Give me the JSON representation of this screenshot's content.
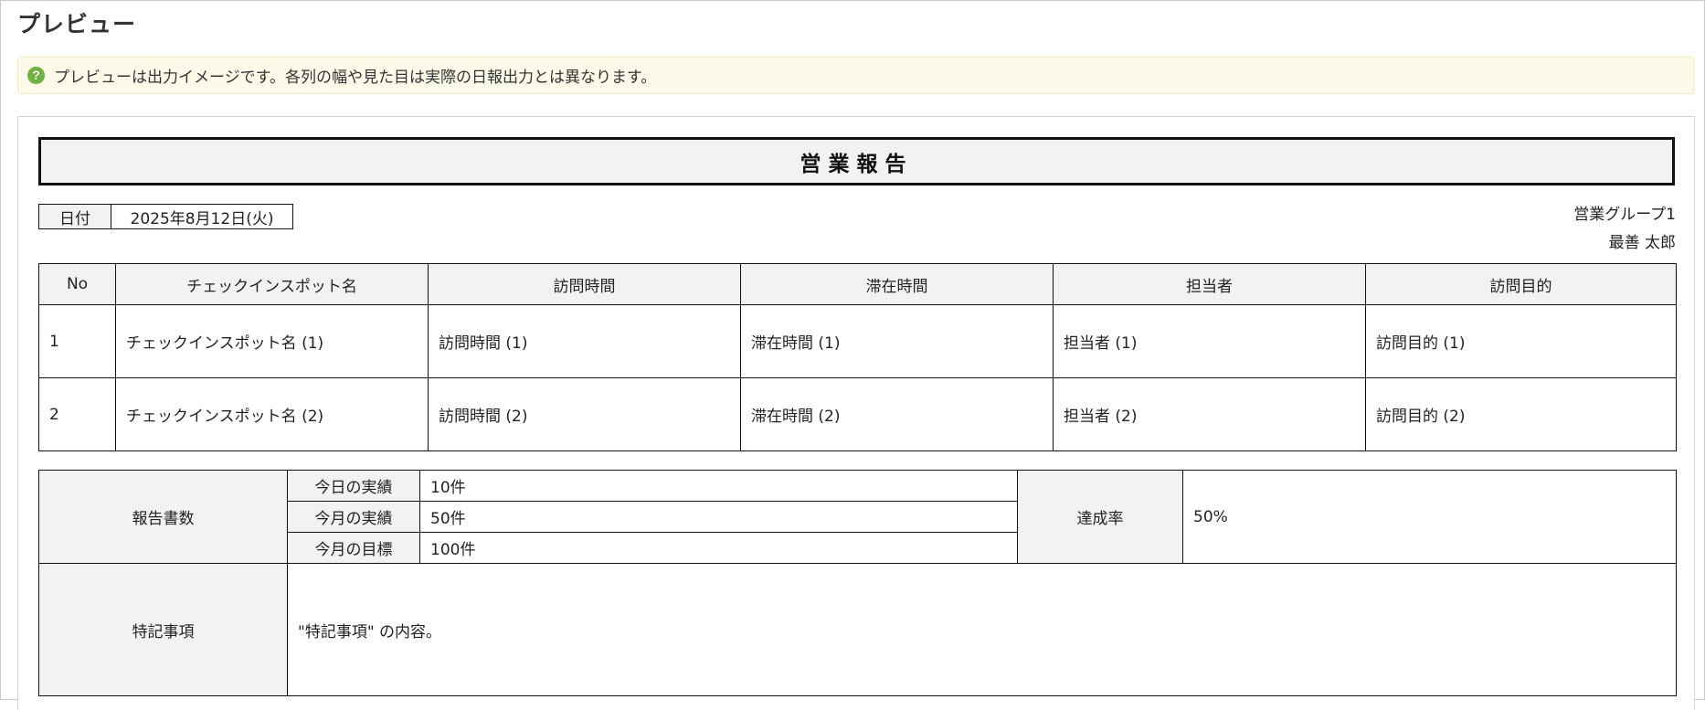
{
  "page": {
    "title": "プレビュー",
    "notice": "プレビューは出力イメージです。各列の幅や見た目は実際の日報出力とは異なります。"
  },
  "report": {
    "title": "営業報告",
    "date_label": "日付",
    "date_value": "2025年8月12日(火)",
    "group": "営業グループ1",
    "user": "最善 太郎"
  },
  "visits": {
    "columns": [
      "No",
      "チェックインスポット名",
      "訪問時間",
      "滞在時間",
      "担当者",
      "訪問目的"
    ],
    "rows": [
      [
        "1",
        "チェックインスポット名 (1)",
        "訪問時間 (1)",
        "滞在時間 (1)",
        "担当者 (1)",
        "訪問目的 (1)"
      ],
      [
        "2",
        "チェックインスポット名 (2)",
        "訪問時間 (2)",
        "滞在時間 (2)",
        "担当者 (2)",
        "訪問目的 (2)"
      ]
    ]
  },
  "summary": {
    "reports_label": "報告書数",
    "today_label": "今日の実績",
    "today_value": "10件",
    "month_label": "今月の実績",
    "month_value": "50件",
    "target_label": "今月の目標",
    "target_value": "100件",
    "rate_label": "達成率",
    "rate_value": "50%",
    "notes_label": "特記事項",
    "notes_value": "\"特記事項\" の内容。"
  },
  "colors": {
    "header_bg": "#f2f2f2",
    "notice_bg": "#fcfbe9",
    "help_icon": "#6cb33f"
  }
}
